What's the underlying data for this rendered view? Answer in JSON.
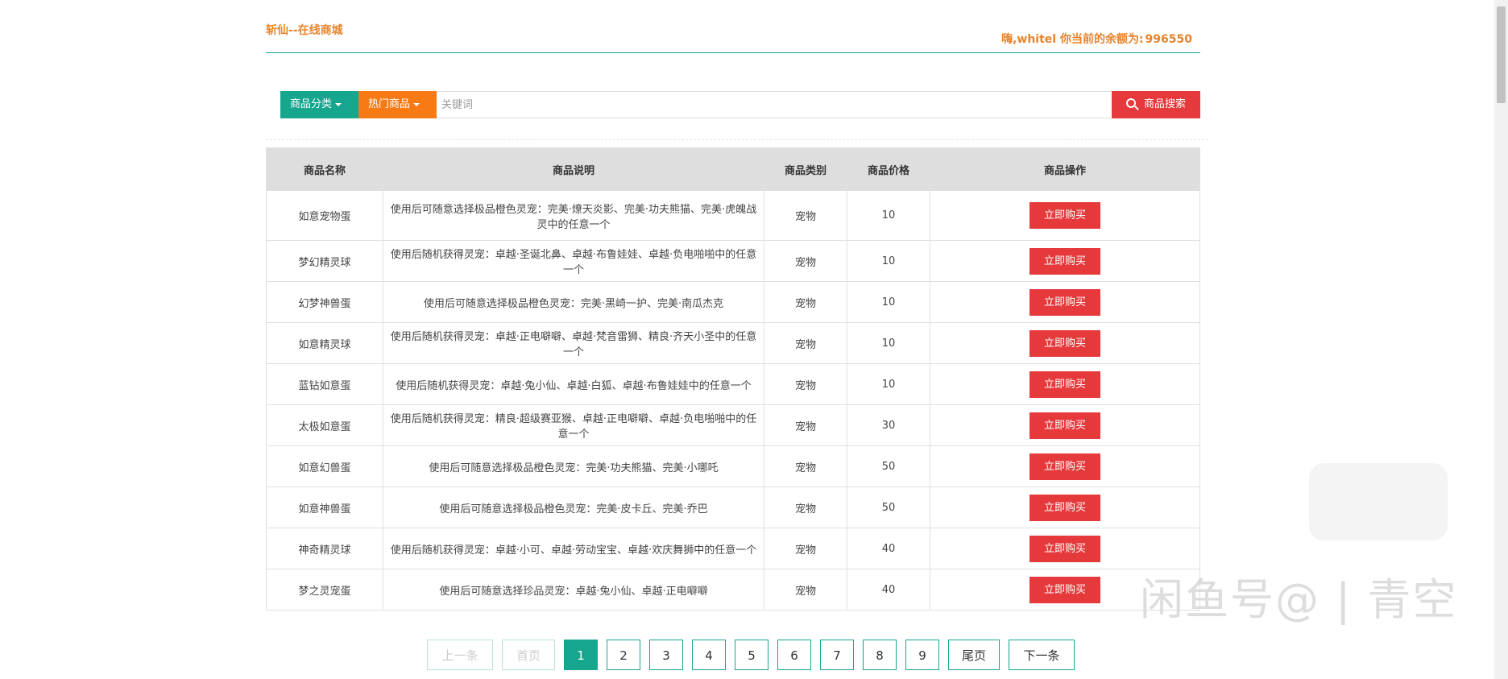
{
  "header": {
    "brand": "斩仙--在线商城",
    "balance_prefix": "嗨,whitel 你当前的余额为:",
    "balance_amount": "996550"
  },
  "search": {
    "category_label": "商品分类",
    "hot_label": "热门商品",
    "placeholder": "关键词",
    "button_label": "商品搜索"
  },
  "table": {
    "headers": [
      "商品名称",
      "商品说明",
      "商品类别",
      "商品价格",
      "商品操作"
    ],
    "rows": [
      {
        "name": "如意宠物蛋",
        "desc": "使用后可随意选择极品橙色灵宠：完美·燎天炎影、完美·功夫熊猫、完美·虎魄战灵中的任意一个",
        "type": "宠物",
        "price": "10",
        "action": "立即购买"
      },
      {
        "name": "梦幻精灵球",
        "desc": "使用后随机获得灵宠：卓越·圣诞北鼻、卓越·布鲁娃娃、卓越·负电啪啪中的任意一个",
        "type": "宠物",
        "price": "10",
        "action": "立即购买"
      },
      {
        "name": "幻梦神兽蛋",
        "desc": "使用后可随意选择极品橙色灵宠：完美·黑崎一护、完美·南瓜杰克",
        "type": "宠物",
        "price": "10",
        "action": "立即购买"
      },
      {
        "name": "如意精灵球",
        "desc": "使用后随机获得灵宠：卓越·正电噼噼、卓越·梵音雷狮、精良·齐天小圣中的任意一个",
        "type": "宠物",
        "price": "10",
        "action": "立即购买"
      },
      {
        "name": "蓝钻如意蛋",
        "desc": "使用后随机获得灵宠：卓越·兔小仙、卓越·白狐、卓越·布鲁娃娃中的任意一个",
        "type": "宠物",
        "price": "10",
        "action": "立即购买"
      },
      {
        "name": "太极如意蛋",
        "desc": "使用后随机获得灵宠：精良·超级赛亚猴、卓越·正电噼噼、卓越·负电啪啪中的任意一个",
        "type": "宠物",
        "price": "30",
        "action": "立即购买"
      },
      {
        "name": "如意幻兽蛋",
        "desc": "使用后可随意选择极品橙色灵宠：完美·功夫熊猫、完美·小哪吒",
        "type": "宠物",
        "price": "50",
        "action": "立即购买"
      },
      {
        "name": "如意神兽蛋",
        "desc": "使用后可随意选择极品橙色灵宠：完美·皮卡丘、完美·乔巴",
        "type": "宠物",
        "price": "50",
        "action": "立即购买"
      },
      {
        "name": "神奇精灵球",
        "desc": "使用后随机获得灵宠：卓越·小可、卓越·劳动宝宝、卓越·欢庆舞狮中的任意一个",
        "type": "宠物",
        "price": "40",
        "action": "立即购买"
      },
      {
        "name": "梦之灵宠蛋",
        "desc": "使用后可随意选择珍品灵宠：卓越·兔小仙、卓越·正电噼噼",
        "type": "宠物",
        "price": "40",
        "action": "立即购买"
      }
    ]
  },
  "pagination": {
    "prev": "上一条",
    "first": "首页",
    "pages": [
      "1",
      "2",
      "3",
      "4",
      "5",
      "6",
      "7",
      "8",
      "9"
    ],
    "current": "1",
    "last": "尾页",
    "next": "下一条"
  },
  "watermark": {
    "text": "闲鱼号@ | 青空"
  },
  "colors": {
    "accent": "#16a68e",
    "brand_orange": "#e8832a",
    "hot_orange": "#f77a15",
    "buy_red": "#e5393c",
    "header_gray": "#dedede"
  }
}
